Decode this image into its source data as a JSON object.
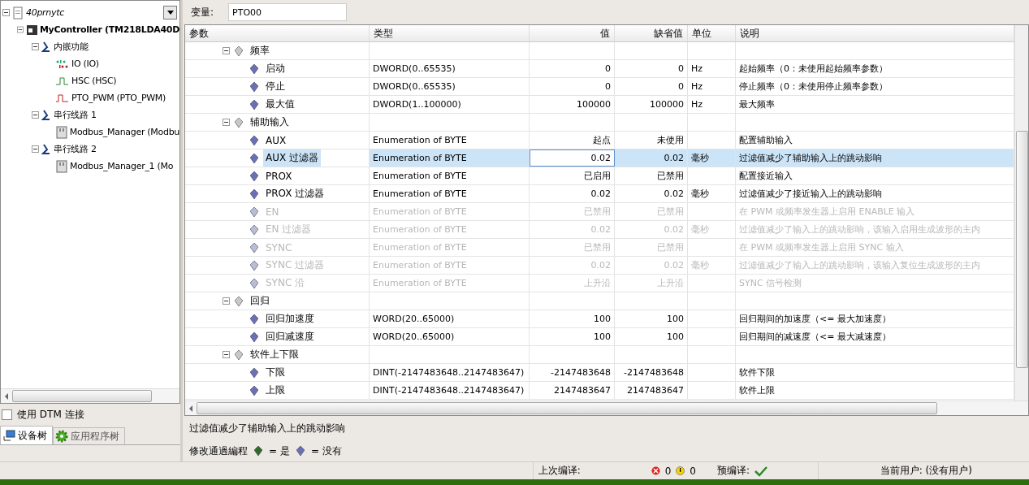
{
  "project_tree": [
    {
      "label": "40prnytc",
      "kind": "project",
      "expanded": true,
      "children": [
        {
          "label": "MyController (TM218LDA40D",
          "kind": "controller",
          "expanded": true,
          "children": [
            {
              "label": "内嵌功能",
              "kind": "folder",
              "expanded": true,
              "children": [
                {
                  "label": "IO (IO)",
                  "kind": "io"
                },
                {
                  "label": "HSC (HSC)",
                  "kind": "hsc"
                },
                {
                  "label": "PTO_PWM (PTO_PWM)",
                  "kind": "pto"
                }
              ]
            },
            {
              "label": "串行线路 1",
              "kind": "folder",
              "expanded": true,
              "children": [
                {
                  "label": "Modbus_Manager (Modbu",
                  "kind": "module"
                }
              ]
            },
            {
              "label": "串行线路 2",
              "kind": "folder",
              "expanded": true,
              "children": [
                {
                  "label": "Modbus_Manager_1 (Mo",
                  "kind": "module"
                }
              ]
            }
          ]
        }
      ]
    }
  ],
  "dtm_checkbox": {
    "label": "使用 DTM 连接",
    "checked": false
  },
  "tree_tabs": [
    {
      "label": "设备树",
      "kind": "device",
      "selected": true
    },
    {
      "label": "应用程序树",
      "kind": "app",
      "selected": false
    }
  ],
  "variable": {
    "label": "变量:",
    "value": "PTO00"
  },
  "table": {
    "columns": [
      "参数",
      "类型",
      "值",
      "缺省值",
      "单位",
      "说明"
    ],
    "groups": [
      {
        "name": "频率",
        "expanded": true,
        "children": [
          {
            "name": "启动",
            "type": "DWORD(0..65535)",
            "value": "0",
            "default": "0",
            "unit": "Hz",
            "description": "起始频率（0：未使用起始频率参数）",
            "disabled": false,
            "selected": false
          },
          {
            "name": "停止",
            "type": "DWORD(0..65535)",
            "value": "0",
            "default": "0",
            "unit": "Hz",
            "description": "停止频率（0：未使用停止频率参数）",
            "disabled": false,
            "selected": false
          },
          {
            "name": "最大值",
            "type": "DWORD(1..100000)",
            "value": "100000",
            "default": "100000",
            "unit": "Hz",
            "description": "最大频率",
            "disabled": false,
            "selected": false
          }
        ]
      },
      {
        "name": "辅助输入",
        "expanded": true,
        "children": [
          {
            "name": "AUX",
            "type": "Enumeration of BYTE",
            "value": "起点",
            "default": "未使用",
            "description": "配置辅助输入",
            "disabled": false,
            "selected": false
          },
          {
            "name": "AUX 过滤器",
            "type": "Enumeration of BYTE",
            "value": "0.02",
            "default": "0.02",
            "unit": "毫秒",
            "description": "过滤值减少了辅助输入上的跳动影响",
            "disabled": false,
            "selected": true
          },
          {
            "name": "PROX",
            "type": "Enumeration of BYTE",
            "value": "已启用",
            "default": "已禁用",
            "description": "配置接近输入",
            "disabled": false,
            "selected": false
          },
          {
            "name": "PROX 过滤器",
            "type": "Enumeration of BYTE",
            "value": "0.02",
            "default": "0.02",
            "unit": "毫秒",
            "description": "过滤值减少了接近输入上的跳动影响",
            "disabled": false,
            "selected": false
          },
          {
            "name": "EN",
            "type": "Enumeration of BYTE",
            "value": "已禁用",
            "default": "已禁用",
            "description": "在 PWM 或频率发生器上启用 ENABLE 输入",
            "disabled": true,
            "selected": false
          },
          {
            "name": "EN 过滤器",
            "type": "Enumeration of BYTE",
            "value": "0.02",
            "default": "0.02",
            "unit": "毫秒",
            "description": "过滤值减少了输入上的跳动影响，该输入启用生成波形的主内",
            "disabled": true,
            "selected": false
          },
          {
            "name": "SYNC",
            "type": "Enumeration of BYTE",
            "value": "已禁用",
            "default": "已禁用",
            "description": "在 PWM 或频率发生器上启用 SYNC 输入",
            "disabled": true,
            "selected": false
          },
          {
            "name": "SYNC 过滤器",
            "type": "Enumeration of BYTE",
            "value": "0.02",
            "default": "0.02",
            "unit": "毫秒",
            "description": "过滤值减少了输入上的跳动影响，该输入复位生成波形的主内",
            "disabled": true,
            "selected": false
          },
          {
            "name": "SYNC 沿",
            "type": "Enumeration of BYTE",
            "value": "上升沿",
            "default": "上升沿",
            "description": "SYNC 信号检测",
            "disabled": true,
            "selected": false
          }
        ]
      },
      {
        "name": "回归",
        "expanded": true,
        "children": [
          {
            "name": "回归加速度",
            "type": "WORD(20..65000)",
            "value": "100",
            "default": "100",
            "description": "回归期间的加速度（<= 最大加速度）",
            "disabled": false,
            "selected": false
          },
          {
            "name": "回归减速度",
            "type": "WORD(20..65000)",
            "value": "100",
            "default": "100",
            "description": "回归期间的减速度（<= 最大减速度）",
            "disabled": false,
            "selected": false
          }
        ]
      },
      {
        "name": "软件上下限",
        "expanded": true,
        "children": [
          {
            "name": "下限",
            "type": "DINT(-2147483648..2147483647)",
            "value": "-2147483648",
            "default": "-2147483648",
            "description": "软件下限",
            "disabled": false,
            "selected": false
          },
          {
            "name": "上限",
            "type": "DINT(-2147483648..2147483647)",
            "value": "2147483647",
            "default": "2147483647",
            "description": "软件上限",
            "disabled": false,
            "selected": false
          }
        ]
      }
    ]
  },
  "description_text": "过滤值减少了辅助输入上的跳动影响",
  "legend": {
    "label": "修改通過編程",
    "yes": "= 是",
    "no": "= 没有"
  },
  "status_bar": {
    "last_compile_label": "上次编译:",
    "errors": "0",
    "warnings": "0",
    "precompile_label": "预编译:",
    "precompile_ok": true,
    "user": "当前用户: (没有用户)"
  }
}
